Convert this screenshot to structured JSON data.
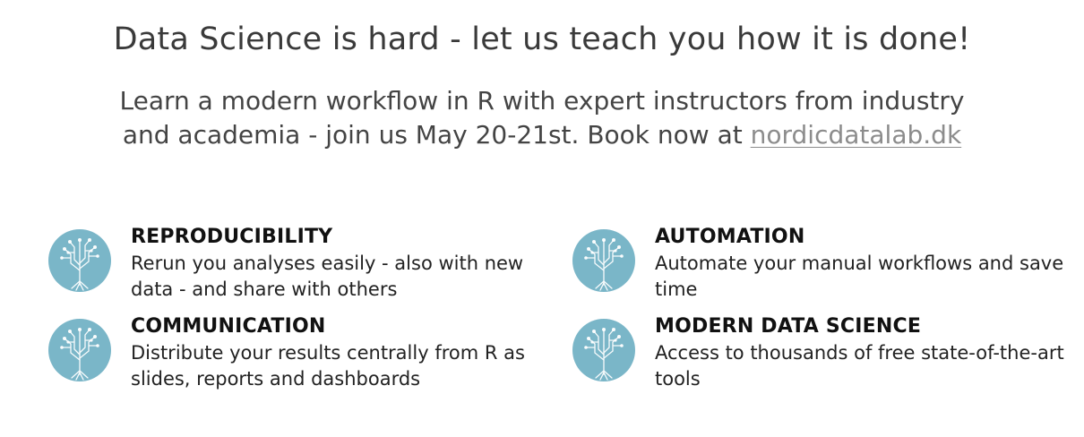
{
  "hero": {
    "headline": "Data Science is hard - let us teach you how it is done!",
    "subline": "Learn a modern workflow in R with expert instructors from industry and academia - join us May 20-21st. Book now at",
    "link_text": "nordicdatalab.dk"
  },
  "features": [
    {
      "icon": "tree-circuit-icon",
      "title": "REPRODUCIBILITY",
      "description": "Rerun you analyses easily - also with new data - and share with others"
    },
    {
      "icon": "tree-circuit-icon",
      "title": "AUTOMATION",
      "description": "Automate your manual workflows and save time"
    },
    {
      "icon": "tree-circuit-icon",
      "title": "COMMUNICATION",
      "description": "Distribute your results centrally from R as slides, reports and dashboards"
    },
    {
      "icon": "tree-circuit-icon",
      "title": "MODERN DATA SCIENCE",
      "description": "Access to thousands of free state-of-the-art tools"
    }
  ],
  "colors": {
    "icon_background": "#7ab6c8",
    "link": "#8c8c8c",
    "heading": "#3a3a3a"
  }
}
